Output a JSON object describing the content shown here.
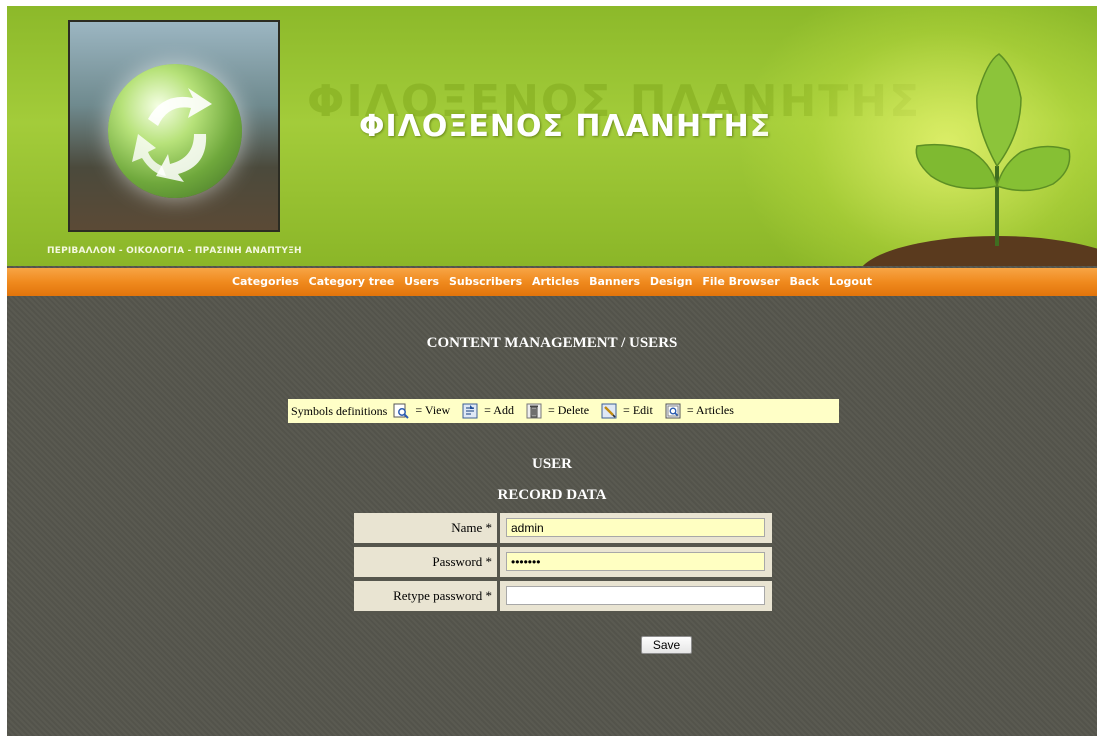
{
  "header": {
    "site_title": "ΦΙΛΟΞΕΝΟΣ ΠΛΑΝΗΤΗΣ",
    "tagline": "ΠΕΡΙΒΑΛΛΟΝ - ΟΙΚΟΛΟΓΙΑ - ΠΡΑΣΙΝΗ ΑΝΑΠΤΥΞΗ"
  },
  "nav": {
    "items": [
      "Categories",
      "Category tree",
      "Users",
      "Subscribers",
      "Articles",
      "Banners",
      "Design",
      "File Browser",
      "Back",
      "Logout"
    ]
  },
  "page": {
    "title": "CONTENT MANAGEMENT / USERS",
    "section_title": "USER",
    "subsection_title": "RECORD DATA"
  },
  "symbols": {
    "label": "Symbols definitions",
    "items": [
      {
        "icon": "view-icon",
        "text": "= View"
      },
      {
        "icon": "add-icon",
        "text": "= Add"
      },
      {
        "icon": "delete-icon",
        "text": "= Delete"
      },
      {
        "icon": "edit-icon",
        "text": "= Edit"
      },
      {
        "icon": "articles-icon",
        "text": "= Articles"
      }
    ]
  },
  "form": {
    "name_label": "Name *",
    "name_value": "admin",
    "password_label": "Password *",
    "password_value": "•••••••",
    "retype_label": "Retype password *",
    "retype_value": "",
    "save_label": "Save"
  },
  "colors": {
    "background": "#56564d",
    "nav_orange": "#f08a1e",
    "banner_green": "#a3cc3a",
    "symbols_bg": "#ffffc7",
    "form_label_bg": "#e9e4d2",
    "input_filled_bg": "#ffffc2"
  }
}
